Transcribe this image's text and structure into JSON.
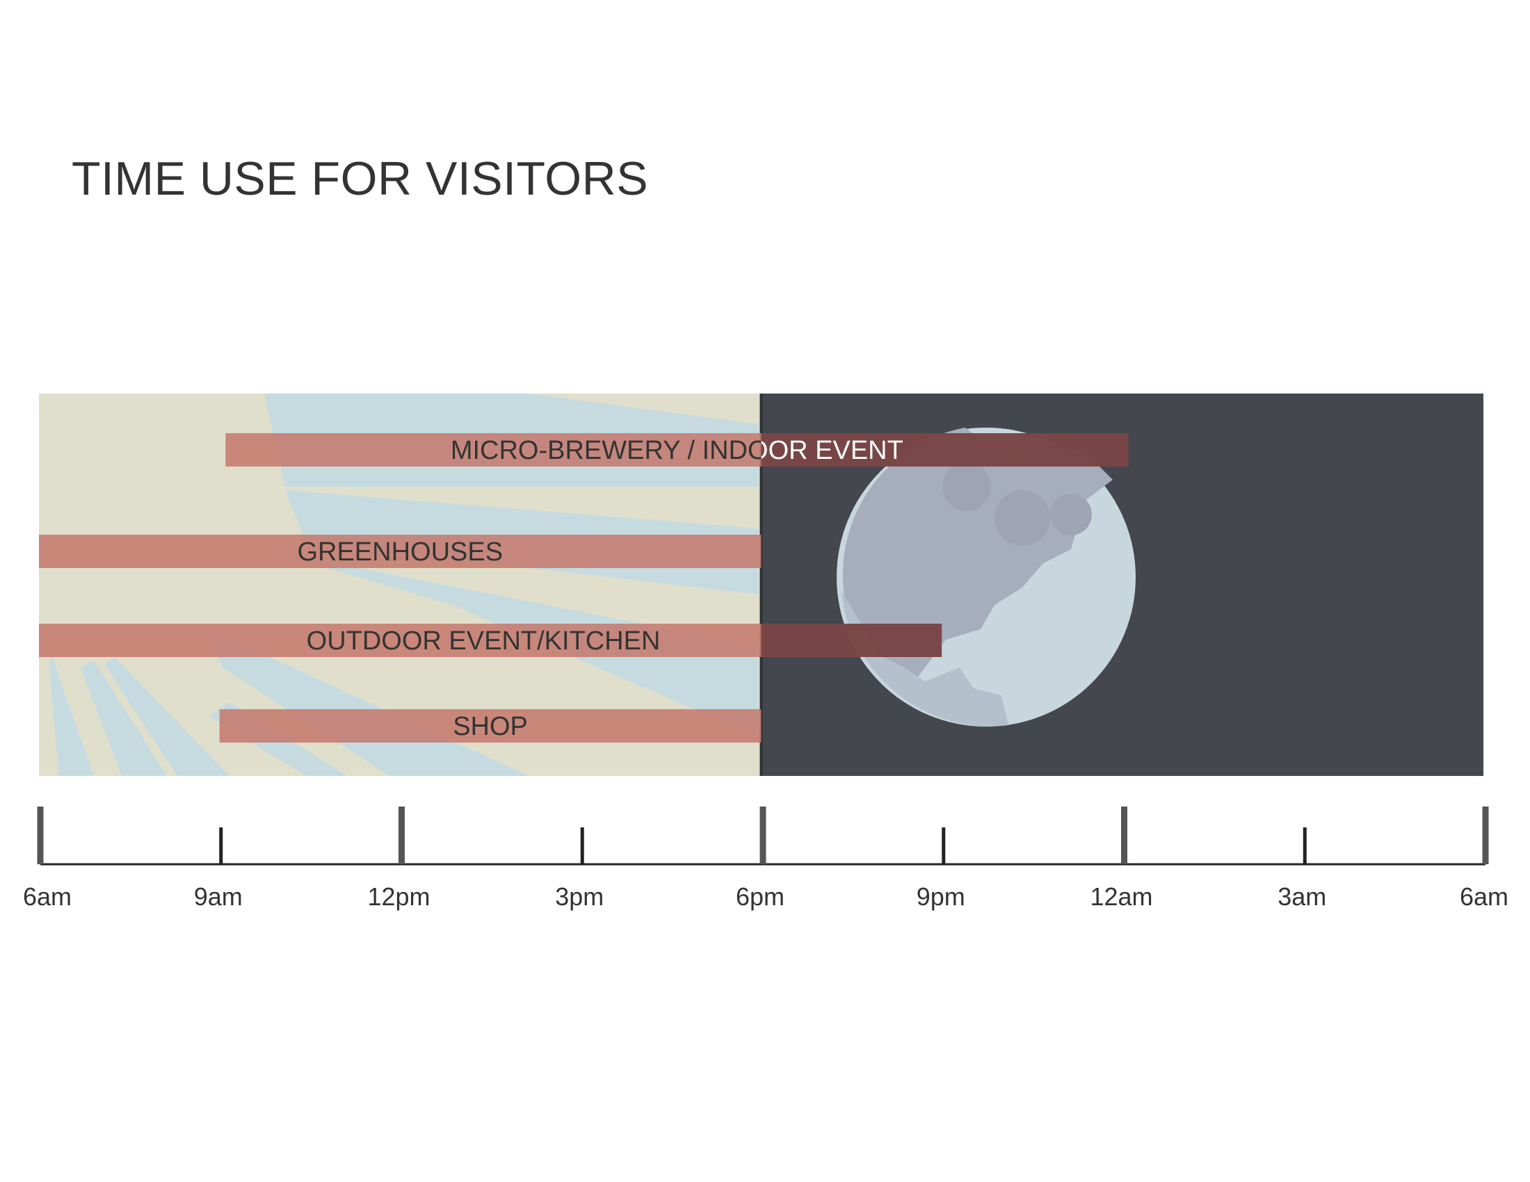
{
  "title": "TIME USE FOR VISITORS",
  "colors": {
    "day_background": "#e0dfcc",
    "sun_rays": "#c6dbe0",
    "night_background": "#44474d",
    "moon_light": "#c8d7de",
    "moon_shadow": "#a6adbc",
    "bar": "#c57b6e",
    "text_dark": "#333333",
    "text_light": "#ffffff"
  },
  "chart_data": {
    "type": "bar",
    "orientation": "horizontal-timeline",
    "title": "TIME USE FOR VISITORS",
    "x_unit": "hours after 6am",
    "xlim": [
      0,
      24
    ],
    "x_ticks": [
      {
        "value": 0,
        "label": "6am"
      },
      {
        "value": 3,
        "label": "9am"
      },
      {
        "value": 6,
        "label": "12pm"
      },
      {
        "value": 9,
        "label": "3pm"
      },
      {
        "value": 12,
        "label": "6pm"
      },
      {
        "value": 15,
        "label": "9pm"
      },
      {
        "value": 18,
        "label": "12am"
      },
      {
        "value": 21,
        "label": "3am"
      },
      {
        "value": 24,
        "label": "6am"
      }
    ],
    "day_night_split": 12,
    "bars": [
      {
        "label": "MICRO-BREWERY / INDOOR EVENT",
        "start": 3.1,
        "end": 18.1,
        "start_label": "9am",
        "end_label": "12am"
      },
      {
        "label": "GREENHOUSES",
        "start": 0,
        "end": 12,
        "start_label": "6am",
        "end_label": "6pm"
      },
      {
        "label": "OUTDOOR EVENT/KITCHEN",
        "start": 0,
        "end": 15,
        "start_label": "6am",
        "end_label": "9pm"
      },
      {
        "label": "SHOP",
        "start": 3,
        "end": 12,
        "start_label": "9am",
        "end_label": "6pm"
      }
    ]
  }
}
